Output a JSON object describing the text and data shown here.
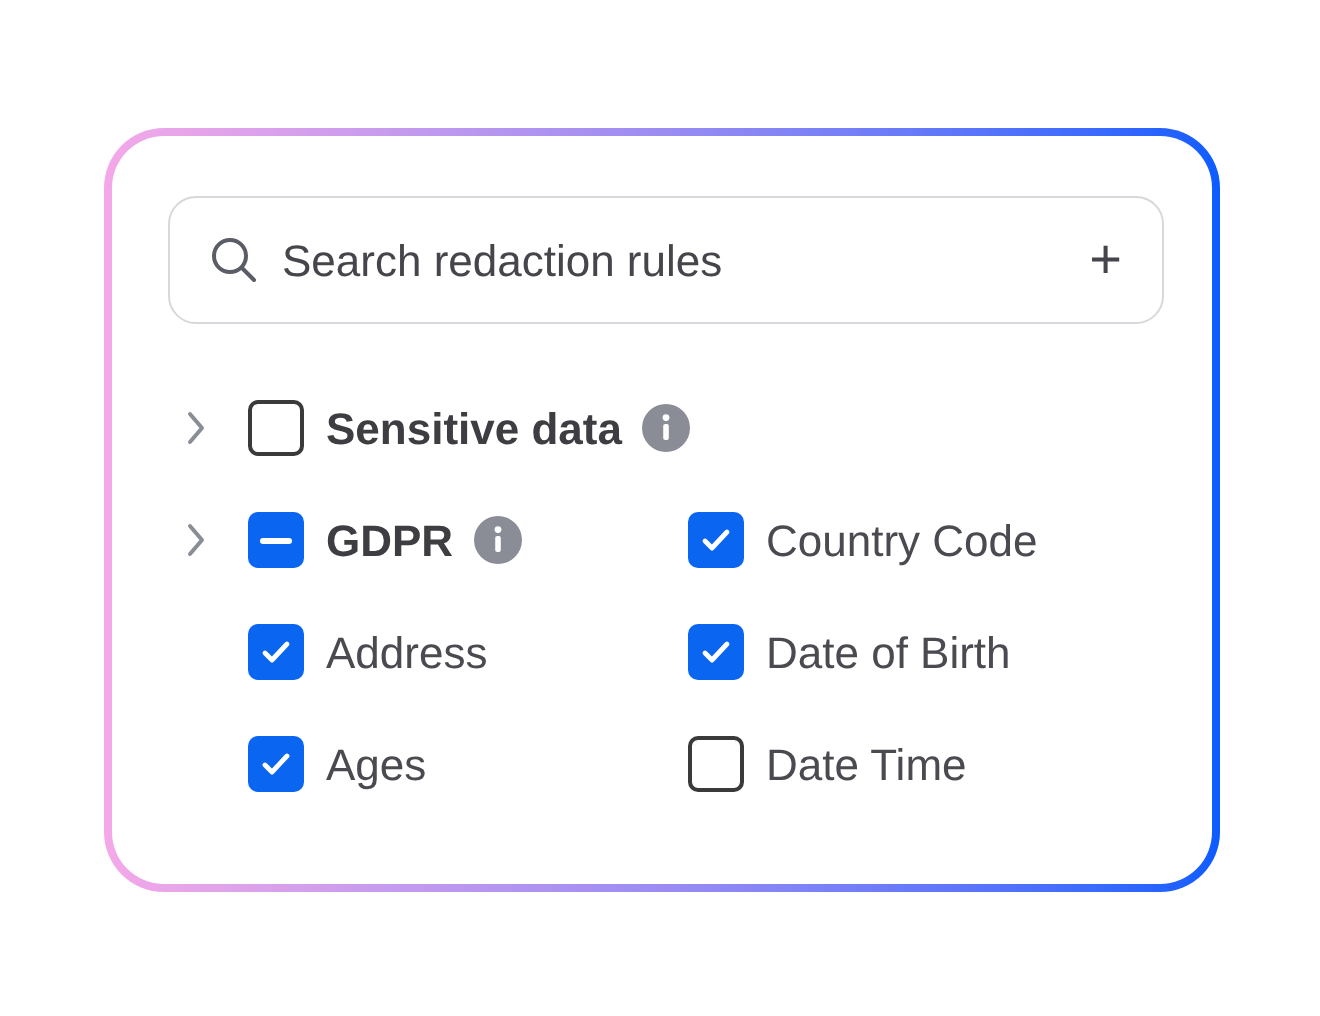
{
  "search": {
    "placeholder": "Search redaction rules",
    "add": "+"
  },
  "groups": [
    {
      "label": "Sensitive data",
      "checked": false,
      "expanded": false,
      "info": true
    },
    {
      "label": "GDPR",
      "checked": true,
      "indeterminate": true,
      "expanded": false,
      "info": true,
      "children": [
        {
          "label": "Country Code",
          "checked": true
        },
        {
          "label": "Address",
          "checked": true
        },
        {
          "label": "Date of Birth",
          "checked": true
        },
        {
          "label": "Ages",
          "checked": true
        },
        {
          "label": "Date Time",
          "checked": false
        }
      ]
    }
  ]
}
